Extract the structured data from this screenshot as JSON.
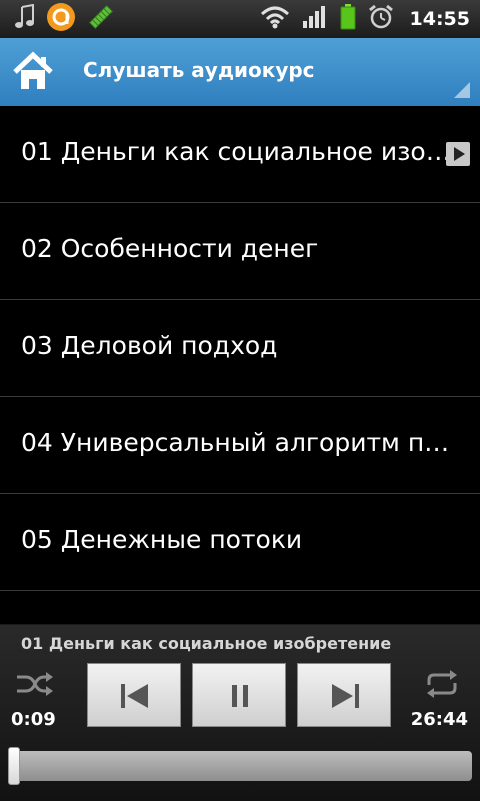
{
  "status_bar": {
    "time": "14:55",
    "icons": [
      "music-note-icon",
      "app-notification-icon",
      "usb-debug-icon",
      "wifi-icon",
      "signal-icon",
      "battery-icon",
      "alarm-icon"
    ]
  },
  "action_bar": {
    "title": "Слушать аудиокурс",
    "home_icon": "home-icon",
    "color": "#3f8fcc"
  },
  "tracks": [
    {
      "title": "01 Деньги как социальное изо…",
      "playing": true
    },
    {
      "title": "02 Особенности денег",
      "playing": false
    },
    {
      "title": "03 Деловой подход",
      "playing": false
    },
    {
      "title": "04 Универсальный алгоритм п…",
      "playing": false
    },
    {
      "title": "05 Денежные потоки",
      "playing": false
    }
  ],
  "player": {
    "now_playing": "01 Деньги как социальное изобретение",
    "elapsed": "0:09",
    "total": "26:44",
    "progress_fraction": 0.006,
    "controls": [
      "shuffle-icon",
      "previous-icon",
      "pause-icon",
      "next-icon",
      "repeat-icon"
    ]
  }
}
